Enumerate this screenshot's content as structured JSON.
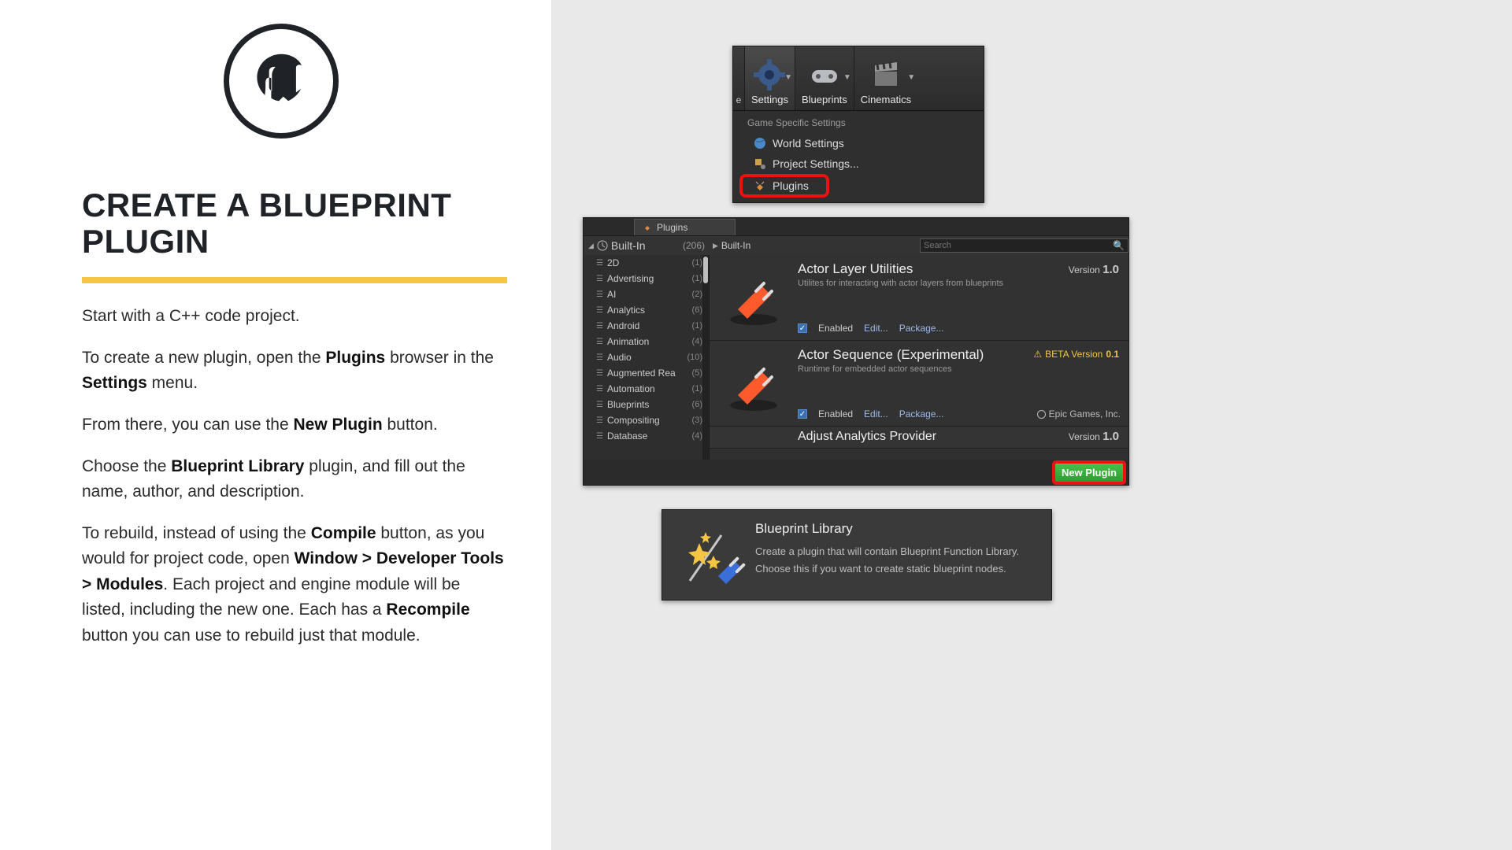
{
  "left": {
    "title": "CREATE A BLUEPRINT PLUGIN",
    "p1": "Start with a C++ code project.",
    "p2a": "To create a new plugin, open the ",
    "p2b": "Plugins",
    "p2c": " browser in the ",
    "p2d": "Settings",
    "p2e": " menu.",
    "p3a": "From there, you can use the ",
    "p3b": "New Plugin",
    "p3c": " button.",
    "p4a": "Choose the ",
    "p4b": "Blueprint Library",
    "p4c": " plugin, and fill out the name, author, and description.",
    "p5a": "To rebuild, instead of using the ",
    "p5b": "Compile",
    "p5c": " button, as you would for project code, open ",
    "p5d": "Window > Developer Tools > Modules",
    "p5e": ". Each project and engine module will be listed, including the new one. Each has a ",
    "p5f": "Recompile",
    "p5g": " button you can use to rebuild just that module."
  },
  "toolbar": {
    "edge_char": "e",
    "settings": "Settings",
    "blueprints": "Blueprints",
    "cinematics": "Cinematics",
    "dd_header": "Game Specific Settings",
    "dd_world": "World Settings",
    "dd_project": "Project Settings...",
    "dd_plugins": "Plugins"
  },
  "plugins_win": {
    "tab": "Plugins",
    "builtin": "Built-In",
    "builtin_count": "(206)",
    "crumb": "Built-In",
    "search_placeholder": "Search",
    "sidebar": [
      {
        "label": "2D",
        "count": "(1)"
      },
      {
        "label": "Advertising",
        "count": "(1)"
      },
      {
        "label": "AI",
        "count": "(2)"
      },
      {
        "label": "Analytics",
        "count": "(6)"
      },
      {
        "label": "Android",
        "count": "(1)"
      },
      {
        "label": "Animation",
        "count": "(4)"
      },
      {
        "label": "Audio",
        "count": "(10)"
      },
      {
        "label": "Augmented Rea",
        "count": "(5)"
      },
      {
        "label": "Automation",
        "count": "(1)"
      },
      {
        "label": "Blueprints",
        "count": "(6)"
      },
      {
        "label": "Compositing",
        "count": "(3)"
      },
      {
        "label": "Database",
        "count": "(4)"
      }
    ],
    "items": [
      {
        "title": "Actor Layer Utilities",
        "desc": "Utilites for interacting with actor layers from blueprints",
        "version_prefix": "Version ",
        "version": "1.0",
        "enabled": "Enabled",
        "edit": "Edit...",
        "package": "Package..."
      },
      {
        "title": "Actor Sequence (Experimental)",
        "desc": "Runtime for embedded actor sequences",
        "beta_prefix": "BETA Version ",
        "beta_ver": "0.1",
        "enabled": "Enabled",
        "edit": "Edit...",
        "package": "Package...",
        "vendor": "Epic Games, Inc."
      },
      {
        "title": "Adjust Analytics Provider",
        "version_prefix": "Version ",
        "version": "1.0"
      }
    ],
    "new_plugin": "New Plugin"
  },
  "bp_card": {
    "title": "Blueprint Library",
    "line1": "Create a plugin that will contain Blueprint Function Library.",
    "line2": "Choose this if you want to create static blueprint nodes."
  }
}
